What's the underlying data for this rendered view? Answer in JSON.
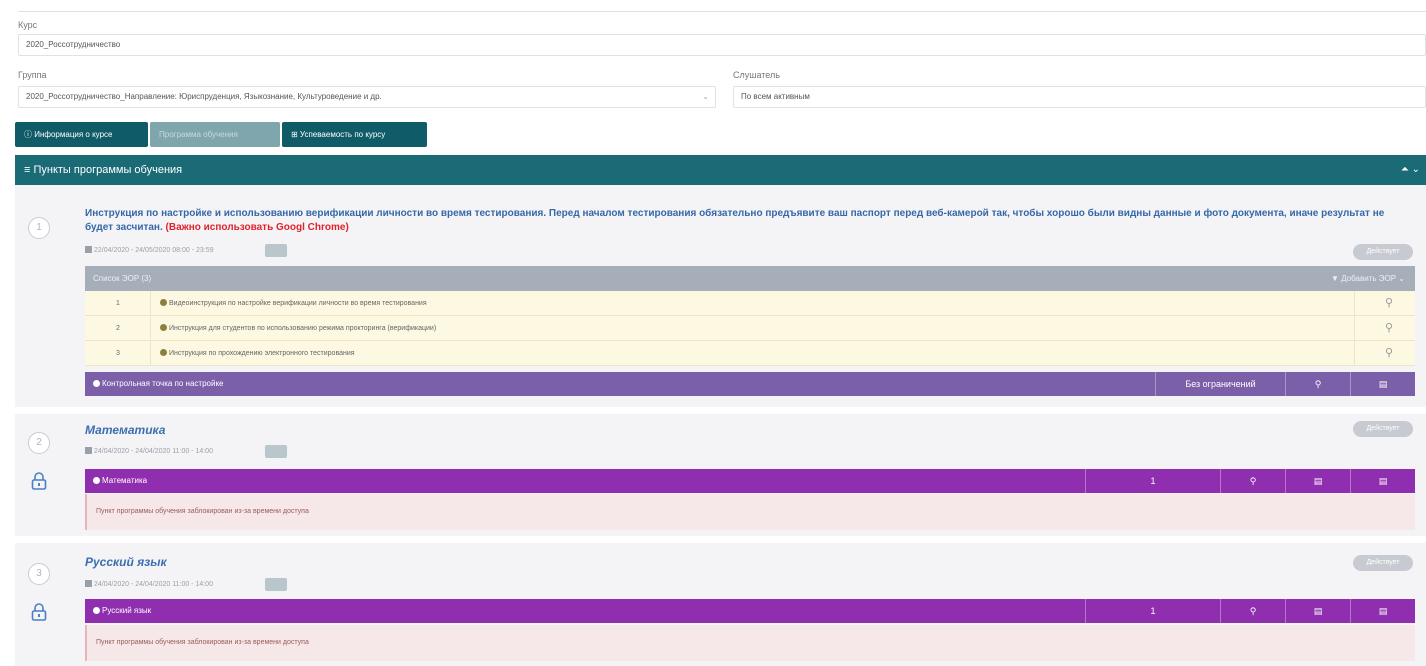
{
  "form": {
    "course_label": "Курс",
    "course_value": "2020_Россотрудничество",
    "group_label": "Группа",
    "group_value": "2020_Россотрудничество_Направление: Юриспруденция, Языкознание, Культуроведение и др.",
    "student_label": "Слушатель",
    "student_value": "По всем активным"
  },
  "tabs": [
    {
      "label": "ⓘ Информация о курсе"
    },
    {
      "label": "Программа обучения"
    },
    {
      "label": "⊞ Успеваемость по курсу"
    }
  ],
  "panel": {
    "title": "≡ Пункты программы обучения",
    "tools": "⏶ ⌄"
  },
  "items": [
    {
      "number": "1",
      "title": "Инструкция по настройке и использованию верификации личности во время тестирования. Перед началом тестирования обязательно предъявите ваш паспорт перед веб-камерой так, чтобы хорошо были видны данные и фото документа, иначе результат не будет засчитан.",
      "title_warning": "(Важно использовать Googl Chrome)",
      "dates": "22/04/2020 - 24/05/2020 08:00 - 23:59",
      "status": "Действует",
      "section_bar": "Список ЭОР (3)",
      "section_bar_right": "▼ Добавить ЭОР ⌄",
      "resources": [
        {
          "n": "1",
          "text": "Видеоинструкция по настройке верификации личности во время тестирования"
        },
        {
          "n": "2",
          "text": "Инструкция для студентов по использованию режима прокторинга (верификации)"
        },
        {
          "n": "3",
          "text": "Инструкция по прохождению электронного тестирования"
        }
      ],
      "footer": {
        "label": "Контрольная точка по настройке",
        "result": "Без ограничений",
        "icon1": "⚲",
        "icon2": "▤"
      }
    },
    {
      "number": "2",
      "title": "Математика",
      "dates": "24/04/2020 - 24/04/2020 11:00 - 14:00",
      "status": "Действует",
      "bar": {
        "label": "Математика",
        "value": "1",
        "icon1": "⚲",
        "icon2": "▤",
        "icon3": "▤"
      },
      "note": "Пункт программы обучения заблокирован из-за времени доступа"
    },
    {
      "number": "3",
      "title": "Русский язык",
      "dates": "24/04/2020 - 24/04/2020 11:00 - 14:00",
      "status": "Действует",
      "bar": {
        "label": "Русский язык",
        "value": "1",
        "icon1": "⚲",
        "icon2": "▤",
        "icon3": "▤"
      },
      "note": "Пункт программы обучения заблокирован из-за времени доступа"
    }
  ]
}
